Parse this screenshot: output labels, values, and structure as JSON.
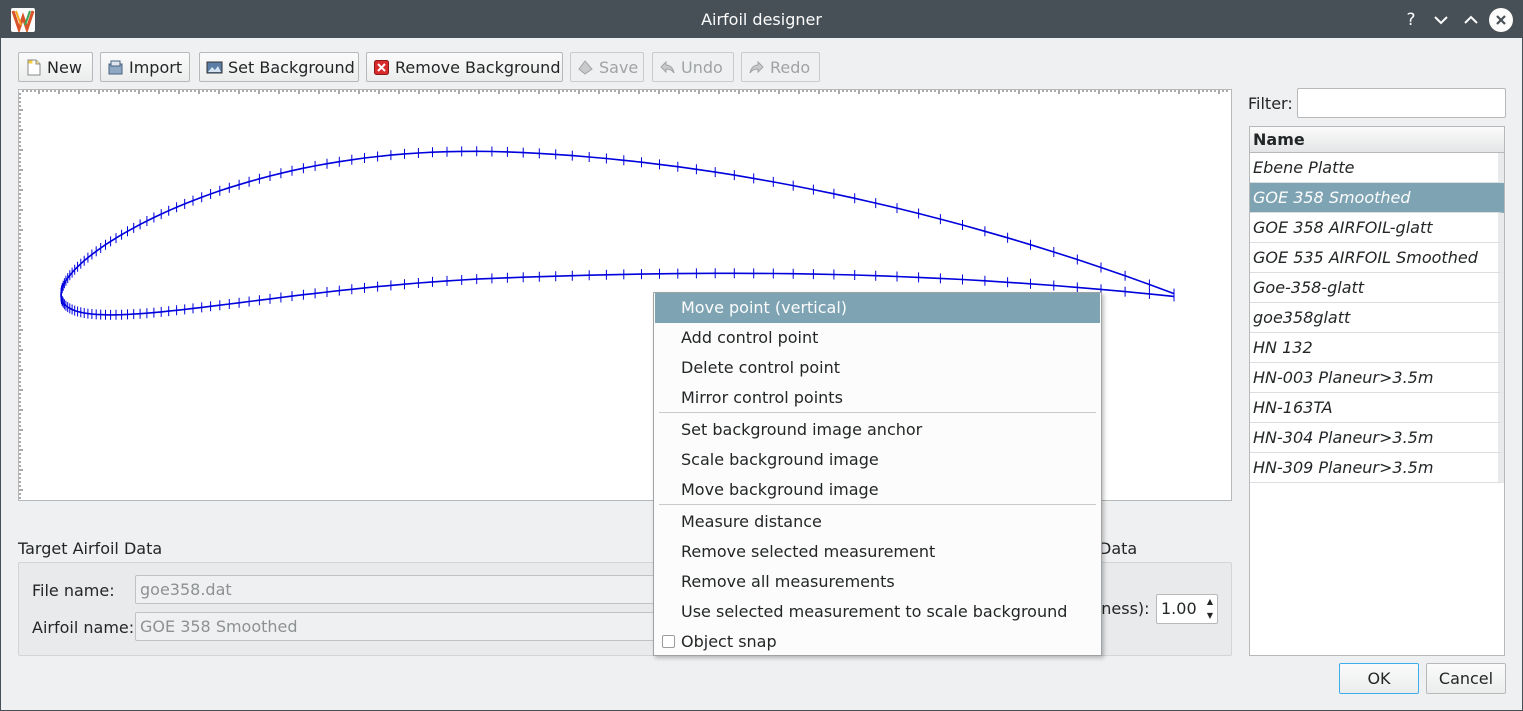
{
  "window": {
    "title": "Airfoil designer"
  },
  "toolbar": {
    "new": "New",
    "import": "Import",
    "set_background": "Set Background",
    "remove_background": "Remove Background",
    "save": "Save",
    "undo": "Undo",
    "redo": "Redo"
  },
  "filter": {
    "label": "Filter:",
    "value": ""
  },
  "list": {
    "header": "Name",
    "items": [
      "Ebene Platte",
      "GOE 358  Smoothed",
      "GOE 358 AIRFOIL-glatt",
      "GOE 535 AIRFOIL Smoothed",
      "Goe-358-glatt",
      "goe358glatt",
      "HN 132",
      "HN-003 Planeur>3.5m",
      "HN-163TA",
      "HN-304 Planeur>3.5m",
      "HN-309 Planeur>3.5m"
    ],
    "selected_index": 1
  },
  "target": {
    "title": "Target Airfoil Data",
    "file_label": "File name:",
    "file_value": "goe358.dat",
    "airfoil_label": "Airfoil name:",
    "airfoil_value": "GOE 358  Smoothed"
  },
  "right_group": {
    "title_fragment": "Data",
    "spin_label_fragment": "tness):",
    "spin_value": "1.00"
  },
  "context_menu": {
    "items": [
      "Move point (vertical)",
      "Add control point",
      "Delete control point",
      "Mirror control points",
      "Set background image anchor",
      "Scale background image",
      "Move background image",
      "Measure distance",
      "Remove selected measurement",
      "Remove all measurements",
      "Use selected measurement to scale background",
      "Object snap"
    ],
    "active_index": 0,
    "object_snap_checked": false
  },
  "buttons": {
    "ok": "OK",
    "cancel": "Cancel"
  },
  "colors": {
    "titlebar": "#475057",
    "selection": "#7ea4b4",
    "airfoil": "#0000dd",
    "focus": "#3daee9"
  }
}
